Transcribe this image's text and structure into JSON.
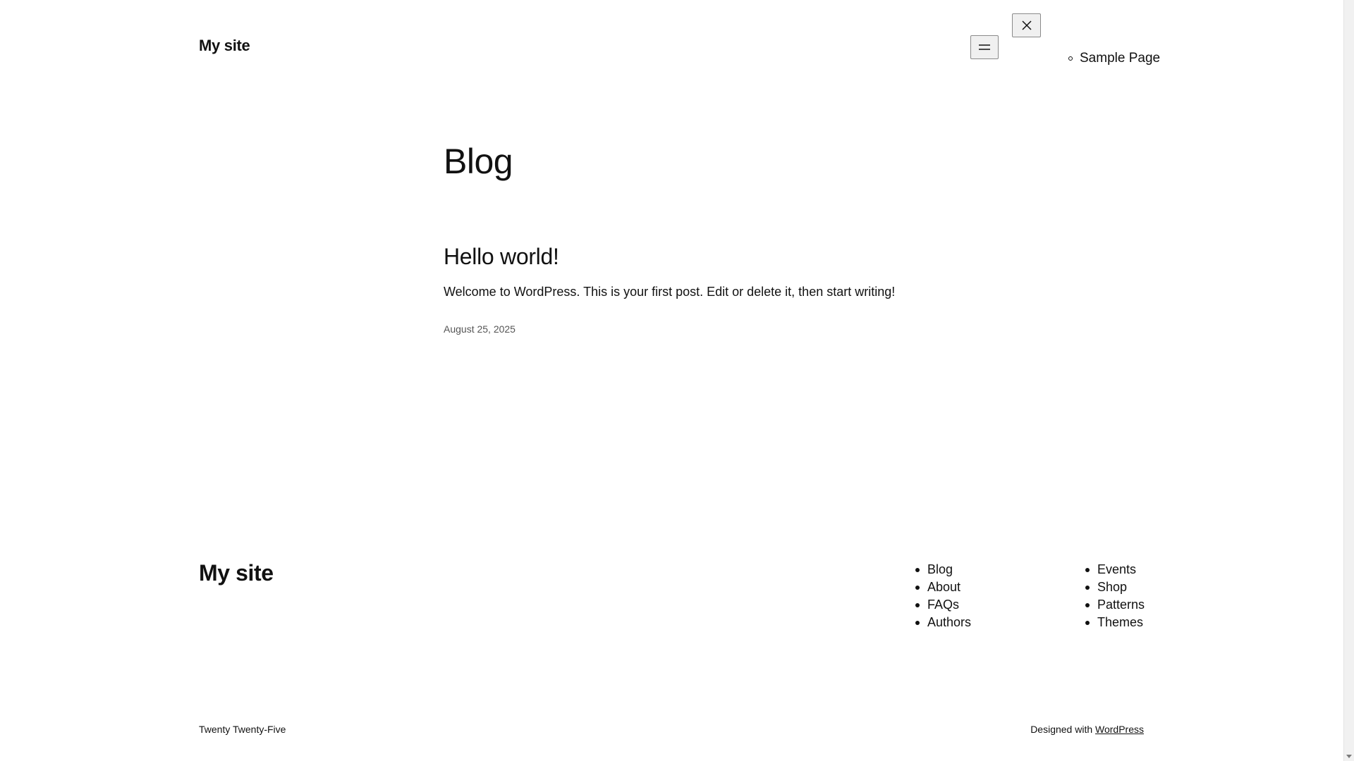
{
  "header": {
    "site_title": "My site",
    "nav_items": [
      {
        "label": "Sample Page"
      }
    ]
  },
  "main": {
    "heading": "Blog",
    "posts": [
      {
        "title": "Hello world!",
        "excerpt": "Welcome to WordPress. This is your first post. Edit or delete it, then start writing!",
        "date": "August 25, 2025"
      }
    ]
  },
  "footer": {
    "site_title": "My site",
    "nav_col_1": [
      {
        "label": "Blog"
      },
      {
        "label": "About"
      },
      {
        "label": "FAQs"
      },
      {
        "label": "Authors"
      }
    ],
    "nav_col_2": [
      {
        "label": "Events"
      },
      {
        "label": "Shop"
      },
      {
        "label": "Patterns"
      },
      {
        "label": "Themes"
      }
    ],
    "theme_name": "Twenty Twenty-Five",
    "designed_with_prefix": "Designed with",
    "designed_with_link": "WordPress"
  },
  "icons": {
    "menu_open": "hamburger-menu-icon",
    "menu_close": "close-icon"
  }
}
